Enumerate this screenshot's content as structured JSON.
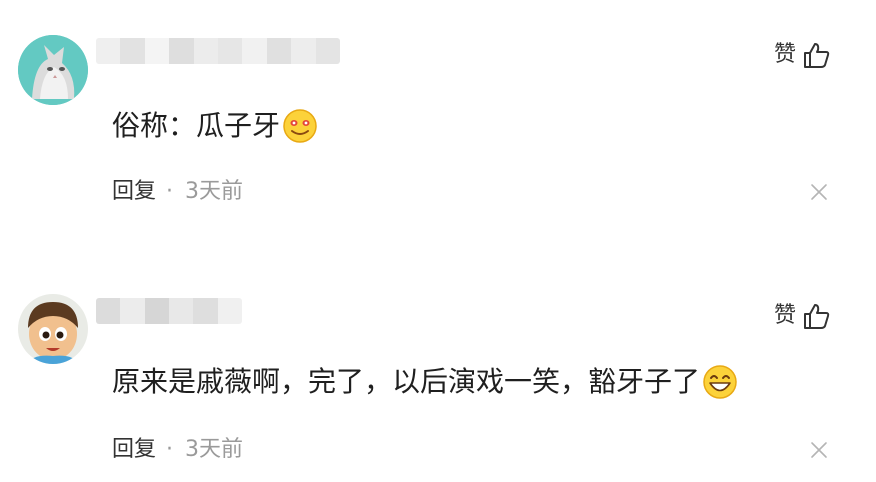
{
  "comments": [
    {
      "avatar_icon": "cat-avatar-icon",
      "like_label": "赞",
      "like_icon": "thumbs-up-icon",
      "text": "俗称：瓜子牙",
      "emoji_icon": "blushing-smile-emoji-icon",
      "reply_label": "回复",
      "separator": "·",
      "time": "3天前",
      "close_icon": "close-icon"
    },
    {
      "avatar_icon": "cartoon-boy-avatar-icon",
      "like_label": "赞",
      "like_icon": "thumbs-up-icon",
      "text": "原来是戚薇啊，完了，以后演戏一笑，豁牙子了",
      "emoji_icon": "grinning-emoji-icon",
      "reply_label": "回复",
      "separator": "·",
      "time": "3天前",
      "close_icon": "close-icon"
    }
  ],
  "colors": {
    "background": "#ffffff",
    "text": "#1f1f1f",
    "secondary_text": "#9a9a9a",
    "icon": "#333333"
  }
}
